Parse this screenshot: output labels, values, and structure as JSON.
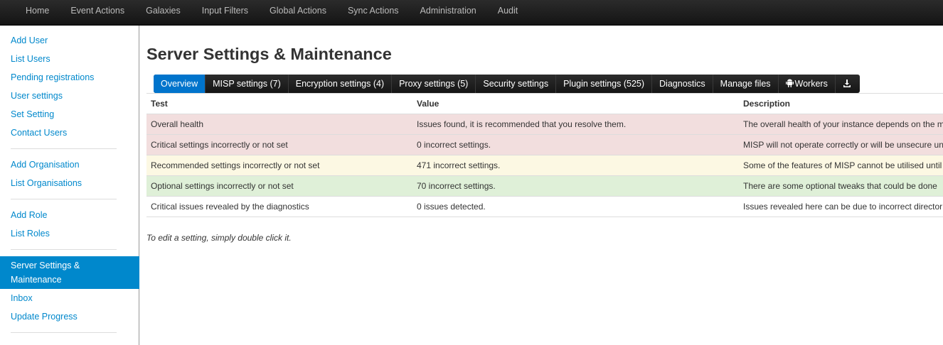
{
  "topnav": {
    "items": [
      "Home",
      "Event Actions",
      "Galaxies",
      "Input Filters",
      "Global Actions",
      "Sync Actions",
      "Administration",
      "Audit"
    ]
  },
  "sidebar": {
    "groups": [
      [
        "Add User",
        "List Users",
        "Pending registrations",
        "User settings",
        "Set Setting",
        "Contact Users"
      ],
      [
        "Add Organisation",
        "List Organisations"
      ],
      [
        "Add Role",
        "List Roles"
      ],
      [
        "Server Settings & Maintenance",
        "Inbox",
        "Update Progress"
      ]
    ],
    "active": "Server Settings & Maintenance"
  },
  "page": {
    "title": "Server Settings & Maintenance",
    "hint": "To edit a setting, simply double click it."
  },
  "tabs": [
    {
      "label": "Overview",
      "active": true
    },
    {
      "label": "MISP settings (7)"
    },
    {
      "label": "Encryption settings (4)"
    },
    {
      "label": "Proxy settings (5)"
    },
    {
      "label": "Security settings"
    },
    {
      "label": "Plugin settings (525)"
    },
    {
      "label": "Diagnostics"
    },
    {
      "label": "Manage files"
    },
    {
      "label": "Workers",
      "icon": "android-icon"
    },
    {
      "label": "",
      "icon": "download-icon"
    }
  ],
  "table": {
    "headers": [
      "Test",
      "Value",
      "Description"
    ],
    "rows": [
      {
        "status": "error",
        "test": "Overall health",
        "value": "Issues found, it is recommended that you resolve them.",
        "description": "The overall health of your instance depends on the m"
      },
      {
        "status": "error",
        "test": "Critical settings incorrectly or not set",
        "value": "0 incorrect settings.",
        "description": "MISP will not operate correctly or will be unsecure un"
      },
      {
        "status": "warning",
        "test": "Recommended settings incorrectly or not set",
        "value": "471 incorrect settings.",
        "description": "Some of the features of MISP cannot be utilised until"
      },
      {
        "status": "success",
        "test": "Optional settings incorrectly or not set",
        "value": "70 incorrect settings.",
        "description": "There are some optional tweaks that could be done"
      },
      {
        "status": "plain",
        "test": "Critical issues revealed by the diagnostics",
        "value": "0 issues detected.",
        "description": "Issues revealed here can be due to incorrect director"
      }
    ]
  },
  "colors": {
    "link": "#0088cc",
    "tab_active": "#0074cc",
    "row_error": "#f2dede",
    "row_warning": "#fcf8e3",
    "row_success": "#dff0d8"
  }
}
